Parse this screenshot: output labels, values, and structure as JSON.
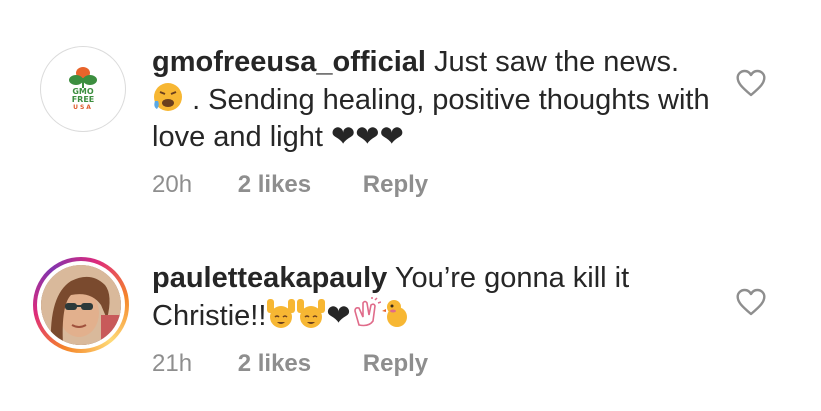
{
  "comments": [
    {
      "username": "gmofreeusa_official",
      "text_part1": "Just saw the news.",
      "text_part2": ". Sending healing, positive thoughts with love and light",
      "hearts": "❤❤❤",
      "time": "20h",
      "likes": "2 likes",
      "reply": "Reply",
      "avatar": {
        "logo_line1": "GMO",
        "logo_line2": "FREE",
        "logo_line3": "USA"
      }
    },
    {
      "username": "pauletteakapauly",
      "text": "You’re gonna kill it Christie!!",
      "heart_after": "❤",
      "time": "21h",
      "likes": "2 likes",
      "reply": "Reply"
    }
  ],
  "icons": {
    "like": "heart-outline-icon",
    "emojis": [
      "tired-face-emoji",
      "raised-hands-emoji",
      "clapping-hands-emoji",
      "chick-emoji"
    ]
  },
  "colors": {
    "text": "#262626",
    "meta": "#8e8e8e",
    "ring_start": "#f58529",
    "ring_end": "#dd2a7b"
  }
}
